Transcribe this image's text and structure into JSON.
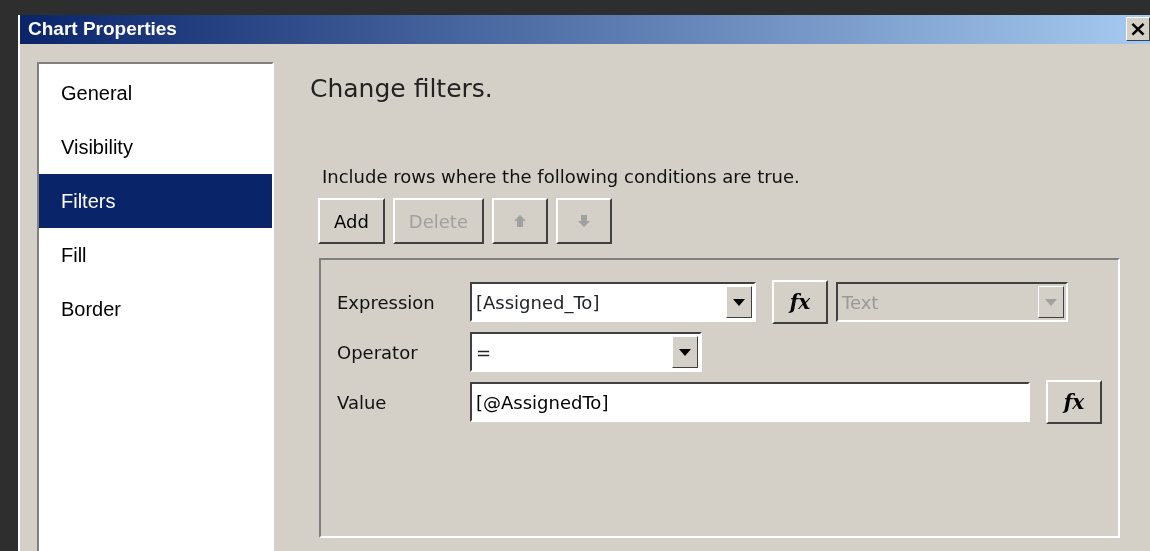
{
  "window": {
    "title": "Chart Properties",
    "close": "×"
  },
  "sidebar": {
    "items": [
      {
        "label": "General",
        "selected": false
      },
      {
        "label": "Visibility",
        "selected": false
      },
      {
        "label": "Filters",
        "selected": true
      },
      {
        "label": "Fill",
        "selected": false
      },
      {
        "label": "Border",
        "selected": false
      }
    ]
  },
  "heading": "Change filters.",
  "instruction": "Include rows where the following conditions are true.",
  "toolbar": [
    {
      "kind": "text",
      "label": "Add",
      "disabled": false
    },
    {
      "kind": "text",
      "label": "Delete",
      "disabled": true
    },
    {
      "kind": "up",
      "disabled": true
    },
    {
      "kind": "down",
      "disabled": true
    }
  ],
  "filter": {
    "expression": {
      "label": "Expression",
      "value": "[Assigned_To]",
      "fx": "fx",
      "type": "Text",
      "type_disabled": true
    },
    "operator": {
      "label": "Operator",
      "value": "="
    },
    "value": {
      "label": "Value",
      "value": "[@AssignedTo]",
      "fx": "fx"
    }
  }
}
